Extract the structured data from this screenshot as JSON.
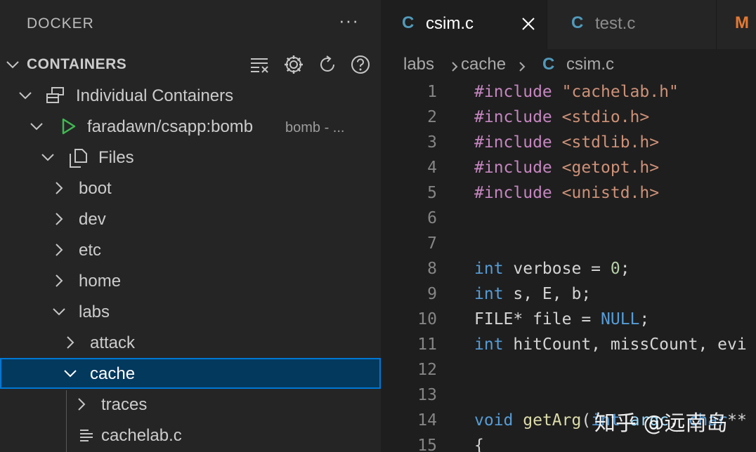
{
  "sidebar": {
    "title": "DOCKER",
    "more_glyph": "···",
    "section": {
      "label": "CONTAINERS",
      "actions": [
        "group-by-icon",
        "settings-gear-icon",
        "refresh-icon",
        "help-icon"
      ]
    },
    "tree": [
      {
        "label": "Individual Containers",
        "icon": "container-group-icon",
        "expanded": true
      },
      {
        "label": "faradawn/csapp:bomb",
        "description": "bomb - ...",
        "icon": "running-play-icon",
        "expanded": true
      },
      {
        "label": "Files",
        "icon": "files-icon",
        "expanded": true
      },
      {
        "label": "boot",
        "expanded": false
      },
      {
        "label": "dev",
        "expanded": false
      },
      {
        "label": "etc",
        "expanded": false
      },
      {
        "label": "home",
        "expanded": false
      },
      {
        "label": "labs",
        "expanded": true
      },
      {
        "label": "attack",
        "expanded": false
      },
      {
        "label": "cache",
        "expanded": true,
        "selected": true
      },
      {
        "label": "traces",
        "expanded": false
      },
      {
        "label": "cachelab.c",
        "icon": "file-lines-icon"
      }
    ]
  },
  "editor": {
    "tabs": [
      {
        "icon": "C",
        "label": "csim.c",
        "active": true
      },
      {
        "icon": "C",
        "label": "test.c",
        "active": false
      },
      {
        "icon": "M",
        "label": ""
      }
    ],
    "breadcrumb": [
      "labs",
      "cache",
      "csim.c"
    ],
    "breadcrumb_icon": "C",
    "code": [
      {
        "n": "1",
        "parts": [
          [
            "dir",
            "#include "
          ],
          [
            "str",
            "\"cachelab.h\""
          ]
        ]
      },
      {
        "n": "2",
        "parts": [
          [
            "dir",
            "#include "
          ],
          [
            "str",
            "<stdio.h>"
          ]
        ]
      },
      {
        "n": "3",
        "parts": [
          [
            "dir",
            "#include "
          ],
          [
            "str",
            "<stdlib.h>"
          ]
        ]
      },
      {
        "n": "4",
        "parts": [
          [
            "dir",
            "#include "
          ],
          [
            "str",
            "<getopt.h>"
          ]
        ]
      },
      {
        "n": "5",
        "parts": [
          [
            "dir",
            "#include "
          ],
          [
            "str",
            "<unistd.h>"
          ]
        ]
      },
      {
        "n": "6",
        "parts": []
      },
      {
        "n": "7",
        "parts": []
      },
      {
        "n": "8",
        "parts": [
          [
            "type",
            "int"
          ],
          [
            "plain",
            " verbose = "
          ],
          [
            "num",
            "0"
          ],
          [
            "plain",
            ";"
          ]
        ]
      },
      {
        "n": "9",
        "parts": [
          [
            "type",
            "int"
          ],
          [
            "plain",
            " s, E, b;"
          ]
        ]
      },
      {
        "n": "10",
        "parts": [
          [
            "plain",
            "FILE* file = "
          ],
          [
            "type",
            "NULL"
          ],
          [
            "plain",
            ";"
          ]
        ]
      },
      {
        "n": "11",
        "parts": [
          [
            "type",
            "int"
          ],
          [
            "plain",
            " hitCount, missCount, evi"
          ]
        ]
      },
      {
        "n": "12",
        "parts": []
      },
      {
        "n": "13",
        "parts": []
      },
      {
        "n": "14",
        "parts": [
          [
            "type",
            "void"
          ],
          [
            "plain",
            " "
          ],
          [
            "fn",
            "getArg"
          ],
          [
            "plain",
            "("
          ],
          [
            "type",
            "int"
          ],
          [
            "plain",
            " "
          ],
          [
            "var",
            "argc"
          ],
          [
            "plain",
            ", "
          ],
          [
            "type",
            "char"
          ],
          [
            "plain",
            "**"
          ]
        ]
      },
      {
        "n": "15",
        "parts": [
          [
            "plain",
            "{"
          ]
        ]
      }
    ]
  },
  "watermark": "知乎 @远南岛",
  "colors": {
    "selection_bg": "#04395e",
    "selection_border": "#0078d4",
    "c_icon": "#519aba",
    "m_icon": "#e37933"
  }
}
